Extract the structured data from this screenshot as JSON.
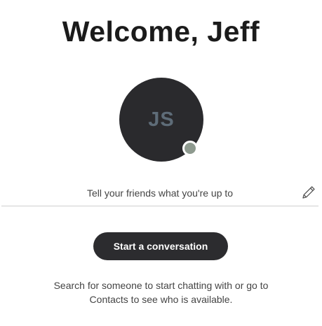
{
  "header": {
    "welcome_text": "Welcome, Jeff"
  },
  "profile": {
    "initials": "JS",
    "presence_color": "#8e9a8f"
  },
  "mood": {
    "placeholder": "Tell your friends what you're up to",
    "edit_icon": "pencil-icon"
  },
  "actions": {
    "start_conversation_label": "Start a conversation"
  },
  "hint": {
    "line1": "Search for someone to start chatting with or go to",
    "line2": "Contacts to see who is available."
  },
  "colors": {
    "button_bg": "#2c2c2f",
    "avatar_bg": "#2a2a2d",
    "initials": "#5e6c78"
  }
}
